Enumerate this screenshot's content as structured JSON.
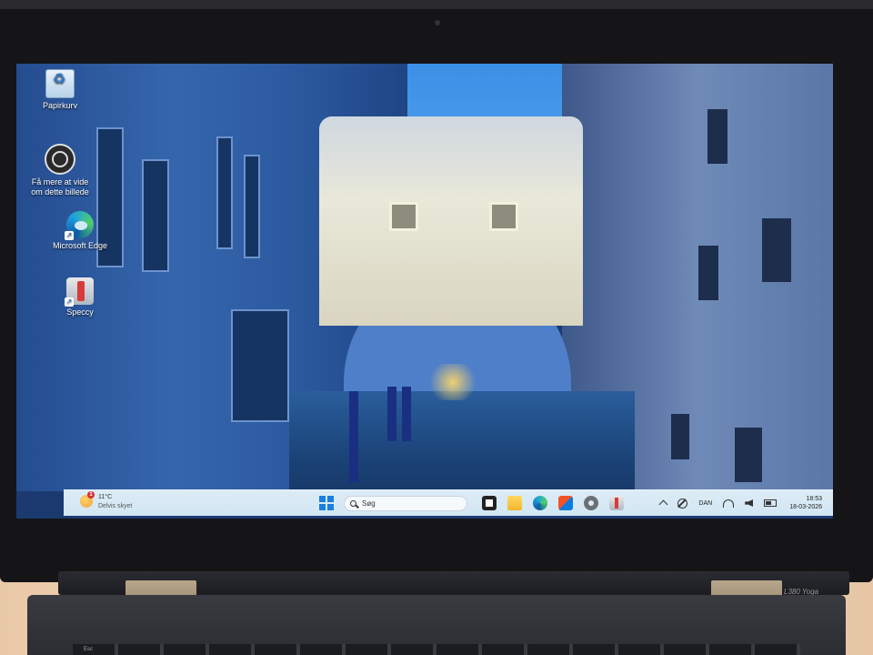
{
  "desktop": {
    "icons": [
      {
        "label": "Papirkurv",
        "icon": "recycle-bin-icon"
      },
      {
        "label": "Få mere at vide om dette billede",
        "icon": "learn-about-picture-icon"
      },
      {
        "label": "Microsoft Edge",
        "icon": "edge-icon"
      },
      {
        "label": "Speccy",
        "icon": "speccy-icon"
      }
    ]
  },
  "taskbar": {
    "weather": {
      "temperature": "11°C",
      "description": "Delvis skyet",
      "badge": "1"
    },
    "search_placeholder": "Søg",
    "apps": [
      "task-view-icon",
      "file-explorer-icon",
      "edge-icon",
      "microsoft-store-icon",
      "settings-icon",
      "speccy-icon"
    ],
    "tray": {
      "language": "DAN",
      "time": "18:53",
      "date": "18-03-2026"
    }
  },
  "device": {
    "model_label": "L380 Yoga",
    "esc_key": "Esc"
  },
  "colors": {
    "taskbar_bg": "#d6e8f4",
    "start_blue": "#1b7fe0",
    "accent_edge": "#1fa0e0"
  }
}
